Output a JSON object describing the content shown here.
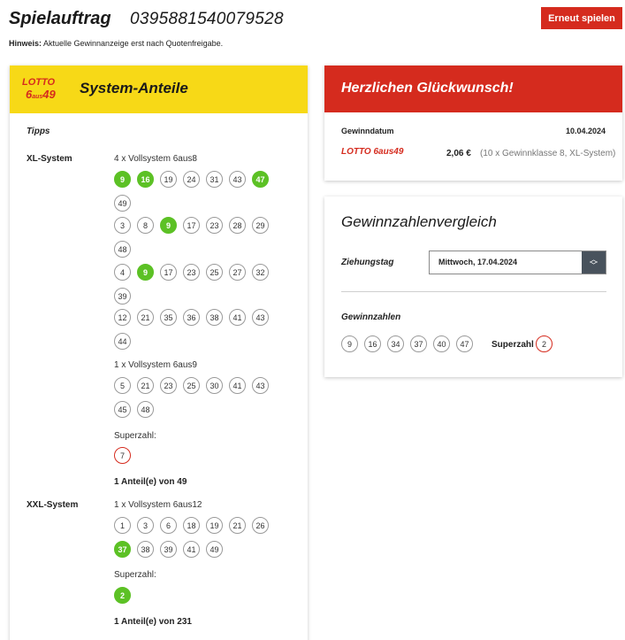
{
  "header": {
    "title": "Spielauftrag",
    "order_number": "0395881540079528",
    "replay_button": "Erneut spielen",
    "hint_label": "Hinweis:",
    "hint_text": " Aktuelle Gewinnanzeige erst nach Quotenfreigabe."
  },
  "left": {
    "logo_line1": "LOTTO",
    "logo_6": "6",
    "logo_aus": "aus",
    "logo_49": "49",
    "title": "System-Anteile",
    "tipps_label": "Tipps",
    "xl": {
      "label": "XL-System",
      "group1_label": "4 x Vollsystem 6aus8",
      "rows": [
        [
          {
            "n": "9",
            "hit": true
          },
          {
            "n": "16",
            "hit": true
          },
          {
            "n": "19"
          },
          {
            "n": "24"
          },
          {
            "n": "31"
          },
          {
            "n": "43"
          },
          {
            "n": "47",
            "hit": true
          },
          {
            "n": "49"
          }
        ],
        [
          {
            "n": "3"
          },
          {
            "n": "8"
          },
          {
            "n": "9",
            "hit": true
          },
          {
            "n": "17"
          },
          {
            "n": "23"
          },
          {
            "n": "28"
          },
          {
            "n": "29"
          },
          {
            "n": "48"
          }
        ],
        [
          {
            "n": "4"
          },
          {
            "n": "9",
            "hit": true
          },
          {
            "n": "17"
          },
          {
            "n": "23"
          },
          {
            "n": "25"
          },
          {
            "n": "27"
          },
          {
            "n": "32"
          },
          {
            "n": "39"
          }
        ],
        [
          {
            "n": "12"
          },
          {
            "n": "21"
          },
          {
            "n": "35"
          },
          {
            "n": "36"
          },
          {
            "n": "38"
          },
          {
            "n": "41"
          },
          {
            "n": "43"
          },
          {
            "n": "44"
          }
        ]
      ],
      "group2_label": "1 x Vollsystem 6aus9",
      "row9": [
        {
          "n": "5"
        },
        {
          "n": "21"
        },
        {
          "n": "23"
        },
        {
          "n": "25"
        },
        {
          "n": "30"
        },
        {
          "n": "41"
        },
        {
          "n": "43"
        },
        {
          "n": "45"
        },
        {
          "n": "48"
        }
      ],
      "superzahl_label": "Superzahl:",
      "superzahl": "7",
      "shares": "1 Anteil(e) von 49"
    },
    "xxl": {
      "label": "XXL-System",
      "group_label": "1 x Vollsystem 6aus12",
      "row12": [
        {
          "n": "1"
        },
        {
          "n": "3"
        },
        {
          "n": "6"
        },
        {
          "n": "18"
        },
        {
          "n": "19"
        },
        {
          "n": "21"
        },
        {
          "n": "26"
        },
        {
          "n": "37",
          "hit": true
        },
        {
          "n": "38"
        },
        {
          "n": "39"
        },
        {
          "n": "41"
        },
        {
          "n": "49"
        }
      ],
      "superzahl_label": "Superzahl:",
      "superzahl": "2",
      "shares": "1 Anteil(e) von 231"
    }
  },
  "win": {
    "title": "Herzlichen Glückwunsch!",
    "date_label": "Gewinndatum",
    "date_value": "10.04.2024",
    "logo_text": "LOTTO 6aus49",
    "amount": "2,06 €",
    "detail": "(10 x Gewinnklasse 8, XL-System)"
  },
  "compare": {
    "title": "Gewinnzahlenvergleich",
    "draw_label": "Ziehungstag",
    "draw_value": "Mittwoch, 17.04.2024",
    "numbers_label": "Gewinnzahlen",
    "numbers": [
      "9",
      "16",
      "34",
      "37",
      "40",
      "47"
    ],
    "superzahl_label": "Superzahl",
    "superzahl": "2"
  },
  "colors": {
    "accent_red": "#d52b1e",
    "lotto_yellow": "#f7d917",
    "hit_green": "#5cc125"
  }
}
